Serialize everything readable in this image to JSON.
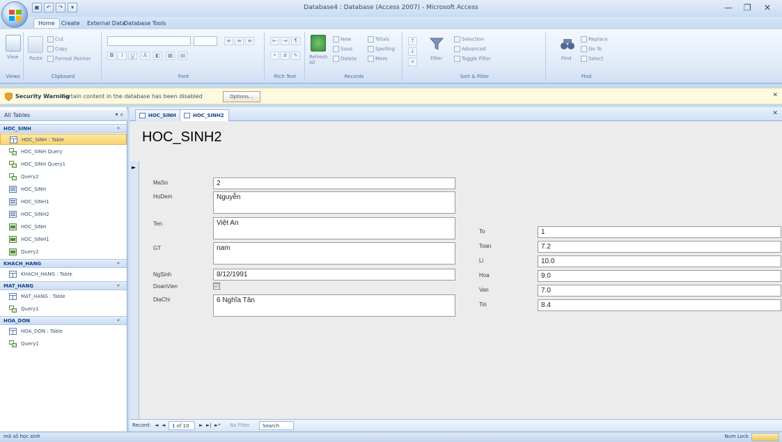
{
  "window": {
    "title": "Database4 : Database (Access 2007) - Microsoft Access",
    "qat_icons": [
      "save-icon",
      "undo-icon",
      "redo-icon",
      "customize-icon"
    ],
    "controls": {
      "minimize": "—",
      "restore": "❐",
      "close": "✕"
    }
  },
  "ribbon": {
    "tabs": [
      {
        "label": "Home",
        "active": true
      },
      {
        "label": "Create",
        "active": false
      },
      {
        "label": "External Data",
        "active": false
      },
      {
        "label": "Database Tools",
        "active": false
      }
    ],
    "groups": {
      "views": {
        "label": "Views",
        "view_label": "View"
      },
      "clipboard": {
        "label": "Clipboard",
        "paste_label": "Paste",
        "cut_label": "Cut",
        "copy_label": "Copy",
        "format_painter_label": "Format Painter"
      },
      "font": {
        "label": "Font"
      },
      "rich_text": {
        "label": "Rich Text"
      },
      "records": {
        "label": "Records",
        "refresh_label": "Refresh All",
        "new_label": "New",
        "save_label": "Save",
        "delete_label": "Delete",
        "totals_label": "Totals",
        "spelling_label": "Spelling",
        "more_label": "More"
      },
      "sort_filter": {
        "label": "Sort & Filter",
        "filter_label": "Filter",
        "selection_label": "Selection",
        "advanced_label": "Advanced",
        "toggle_label": "Toggle Filter"
      },
      "find": {
        "label": "Find",
        "find_label": "Find",
        "replace_label": "Replace",
        "goto_label": "Go To",
        "select_label": "Select"
      }
    }
  },
  "security": {
    "title": "Security Warning",
    "message": "Certain content in the database has been disabled",
    "options_label": "Options..."
  },
  "nav": {
    "header": "All Tables",
    "header_ctrl": "▾ «",
    "groups": [
      {
        "label": "HOC_SINH",
        "chev": "«"
      },
      {
        "label": "KHACH_HANG",
        "chev": "«"
      },
      {
        "label": "MAT_HANG",
        "chev": "«"
      },
      {
        "label": "HOA_DON",
        "chev": "«"
      }
    ],
    "items": [
      {
        "label": "HOC_SINH : Table",
        "icon": "table-icon"
      },
      {
        "label": "HOC_SINH Query",
        "icon": "query-icon"
      },
      {
        "label": "HOC_SINH Query1",
        "icon": "query-icon"
      },
      {
        "label": "Query2",
        "icon": "query-icon"
      },
      {
        "label": "HOC_SINH",
        "icon": "form-icon"
      },
      {
        "label": "HOC_SINH1",
        "icon": "form-icon"
      },
      {
        "label": "HOC_SINH2",
        "icon": "form-icon"
      },
      {
        "label": "HOC_SINH",
        "icon": "report-icon"
      },
      {
        "label": "HOC_SINH1",
        "icon": "report-icon"
      },
      {
        "label": "Query2",
        "icon": "report-icon"
      },
      {
        "label": "KHACH_HANG : Table",
        "icon": "table-icon"
      },
      {
        "label": "MAT_HANG : Table",
        "icon": "table-icon"
      },
      {
        "label": "Query1",
        "icon": "query-icon"
      },
      {
        "label": "HOA_DON : Table",
        "icon": "table-icon"
      },
      {
        "label": "Query1",
        "icon": "query-icon"
      }
    ]
  },
  "doc": {
    "tabs": [
      {
        "label": "HOC_SINH",
        "active": false
      },
      {
        "label": "HOC_SINH2",
        "active": true
      }
    ],
    "close": "✕",
    "form_title": "HOC_SINH2"
  },
  "form": {
    "fields": {
      "maso": {
        "label": "MaSo",
        "value": "2"
      },
      "hodem": {
        "label": "HoDem",
        "value": "Nguyễn"
      },
      "ten": {
        "label": "Ten",
        "value": "Việt An"
      },
      "gt": {
        "label": "GT",
        "value": "nam"
      },
      "ngsinh": {
        "label": "NgSinh",
        "value": "8/12/1991"
      },
      "doanvien": {
        "label": "DoanVien",
        "value": "☑"
      },
      "diachi": {
        "label": "DiaChi",
        "value": "6 Nghĩa Tân"
      },
      "to": {
        "label": "To",
        "value": "1"
      },
      "toan": {
        "label": "Toan",
        "value": "7.2"
      },
      "li": {
        "label": "Li",
        "value": "10.0"
      },
      "hoa": {
        "label": "Hoa",
        "value": "9.0"
      },
      "van": {
        "label": "Van",
        "value": "7.0"
      },
      "tin": {
        "label": "Tin",
        "value": "8.4"
      }
    }
  },
  "recnav": {
    "record_label": "Record:",
    "first": "◄",
    "prev": "◄",
    "position": "1 of 10",
    "next": "►",
    "last": "►|",
    "new": "►*",
    "filter_label": "No Filter",
    "search_label": "Search"
  },
  "status": {
    "left": "mã số học sinh",
    "right": "Num Lock"
  }
}
